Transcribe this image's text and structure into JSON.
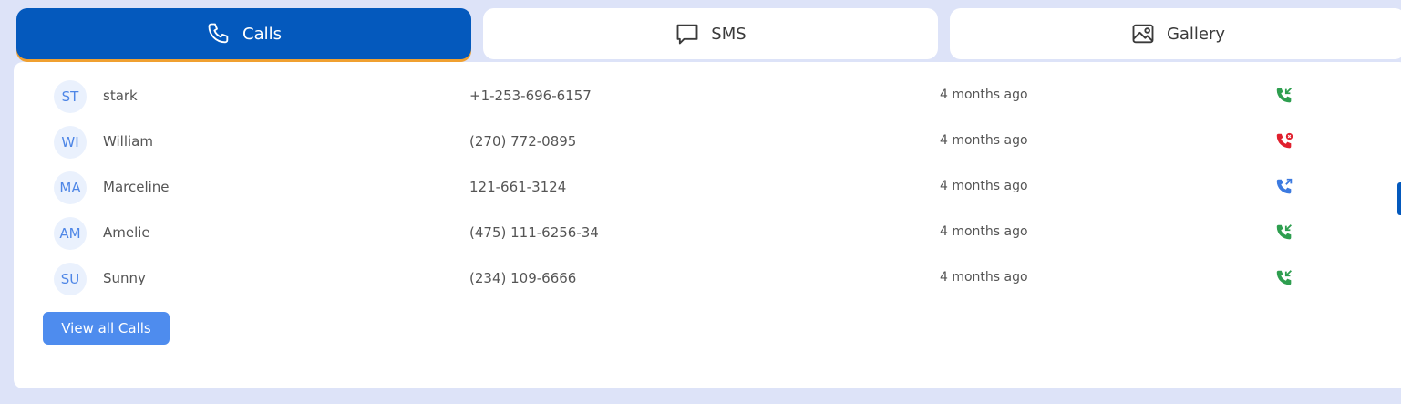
{
  "tabs": [
    {
      "label": "Calls",
      "icon": "phone-icon",
      "active": true
    },
    {
      "label": "SMS",
      "icon": "chat-icon",
      "active": false
    },
    {
      "label": "Gallery",
      "icon": "image-icon",
      "active": false
    }
  ],
  "calls": [
    {
      "initials": "ST",
      "name": "stark",
      "phone": "+1-253-696-6157",
      "time": "4 months ago",
      "type": "incoming",
      "color": "#2e9e4f"
    },
    {
      "initials": "WI",
      "name": "William",
      "phone": "(270) 772-0895",
      "time": "4 months ago",
      "type": "missed",
      "color": "#e0202e"
    },
    {
      "initials": "MA",
      "name": "Marceline",
      "phone": "121-661-3124",
      "time": "4 months ago",
      "type": "outgoing",
      "color": "#3c7ae0"
    },
    {
      "initials": "AM",
      "name": "Amelie",
      "phone": "(475) 111-6256-34",
      "time": "4 months ago",
      "type": "incoming",
      "color": "#2e9e4f"
    },
    {
      "initials": "SU",
      "name": "Sunny",
      "phone": "(234) 109-6666",
      "time": "4 months ago",
      "type": "incoming",
      "color": "#2e9e4f"
    }
  ],
  "view_all_label": "View all Calls",
  "colors": {
    "accent": "#0459bd",
    "button": "#4e8cee",
    "background": "#dde3f8"
  }
}
